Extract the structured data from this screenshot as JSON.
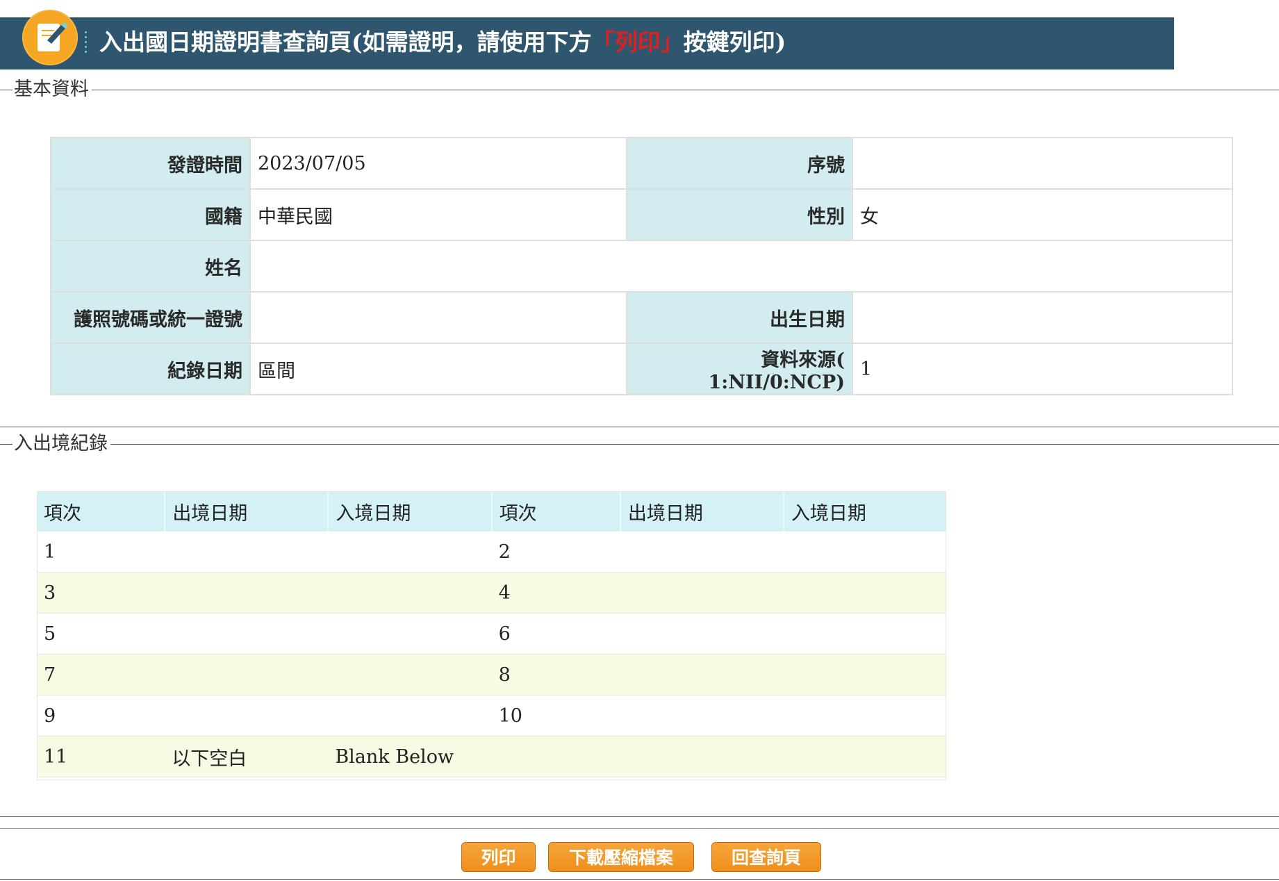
{
  "header": {
    "title_prefix": "入出國日期證明書查詢頁(如需證明，請使用下方",
    "title_highlight": "「列印」",
    "title_suffix": "按鍵列印)",
    "icon": "edit-note-icon",
    "bar_color": "#2e566e",
    "icon_color": "#f5a623"
  },
  "basic_info": {
    "legend": "基本資料",
    "rows": [
      [
        {
          "label": "發證時間",
          "value": "2023/07/05"
        },
        {
          "label": "序號",
          "value": ""
        }
      ],
      [
        {
          "label": "國籍",
          "value": "中華民國"
        },
        {
          "label": "性別",
          "value": "女"
        }
      ],
      [
        {
          "label": "姓名",
          "value": ""
        }
      ],
      [
        {
          "label": "護照號碼或統一證號",
          "value": ""
        },
        {
          "label": "出生日期",
          "value": ""
        }
      ],
      [
        {
          "label": "紀錄日期",
          "value": "區間"
        },
        {
          "label": "資料來源( 1:NII/0:NCP)",
          "value": "1"
        }
      ]
    ],
    "label_color": "#d2ecef"
  },
  "records": {
    "legend": "入出境紀錄",
    "headers": [
      "項次",
      "出境日期",
      "入境日期",
      "項次",
      "出境日期",
      "入境日期"
    ],
    "rows": [
      [
        "1",
        "",
        "",
        "2",
        "",
        ""
      ],
      [
        "3",
        "",
        "",
        "4",
        "",
        ""
      ],
      [
        "5",
        "",
        "",
        "6",
        "",
        ""
      ],
      [
        "7",
        "",
        "",
        "8",
        "",
        ""
      ],
      [
        "9",
        "",
        "",
        "10",
        "",
        ""
      ],
      [
        "11",
        "以下空白",
        "Blank Below",
        "",
        "",
        ""
      ]
    ],
    "header_color": "#d4f1f5",
    "stripe_color": "#f6fbe4"
  },
  "buttons": {
    "print": "列印",
    "download_zip": "下載壓縮檔案",
    "back_to_query": "回查詢頁",
    "color": "#ef8f1c"
  }
}
